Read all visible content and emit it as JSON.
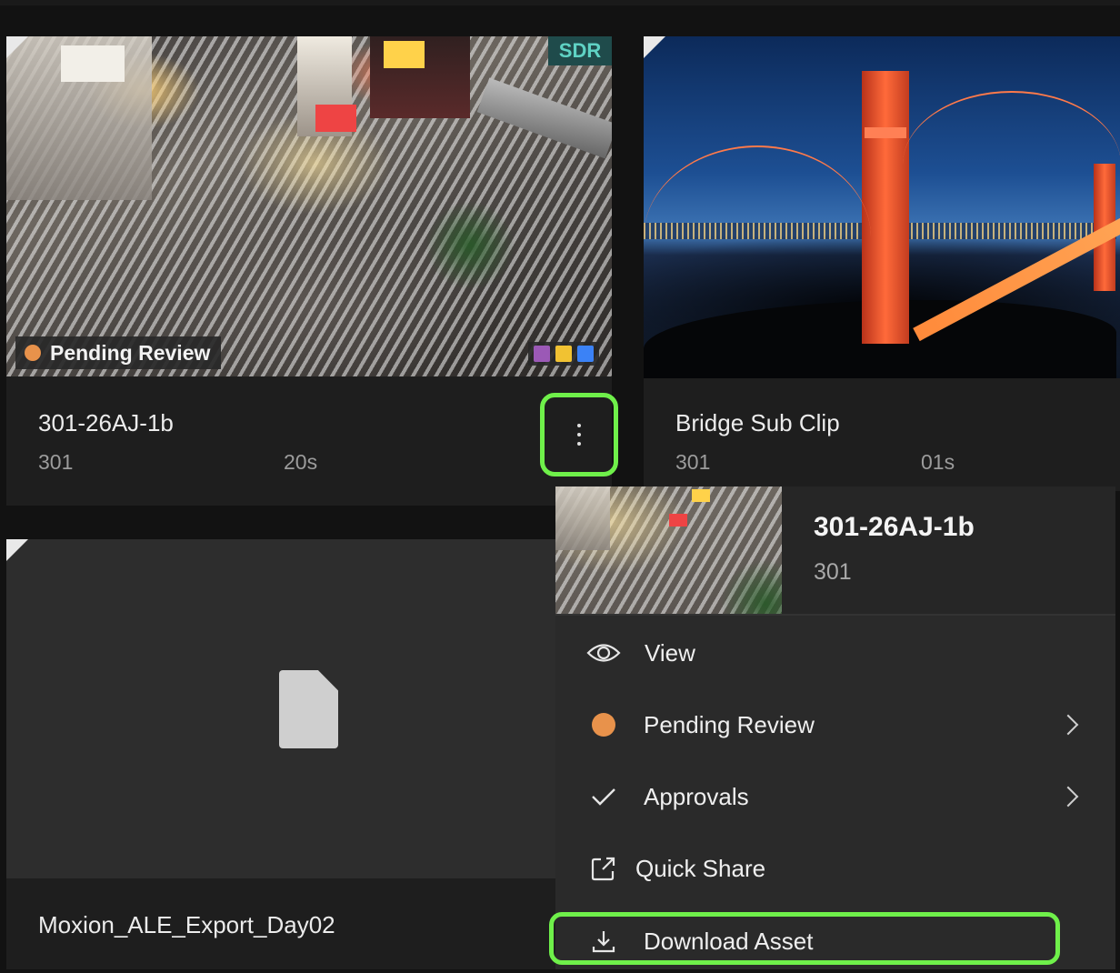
{
  "assets": [
    {
      "title": "301-26AJ-1b",
      "scene": "301",
      "duration": "20s",
      "format_badge": "SDR",
      "status": "Pending Review",
      "status_color": "#e8924b",
      "label_colors": [
        "#9b59b6",
        "#f1c232",
        "#3b82f6"
      ],
      "more_icon": "more-vertical-icon"
    },
    {
      "title": "Bridge Sub Clip",
      "scene": "301",
      "duration": "01s"
    },
    {
      "title": "Moxion_ALE_Export_Day02",
      "file_icon": "document-icon"
    }
  ],
  "context_menu": {
    "title": "301-26AJ-1b",
    "subtitle": "301",
    "items": [
      {
        "label": "View",
        "icon": "eye-icon"
      },
      {
        "label": "Pending Review",
        "icon": "status-dot-icon",
        "submenu": true
      },
      {
        "label": "Approvals",
        "icon": "checkmark-icon",
        "submenu": true
      },
      {
        "label": "Quick Share",
        "icon": "share-icon"
      },
      {
        "label": "Download Asset",
        "icon": "download-icon"
      }
    ]
  },
  "highlight_color": "#6ff04a"
}
